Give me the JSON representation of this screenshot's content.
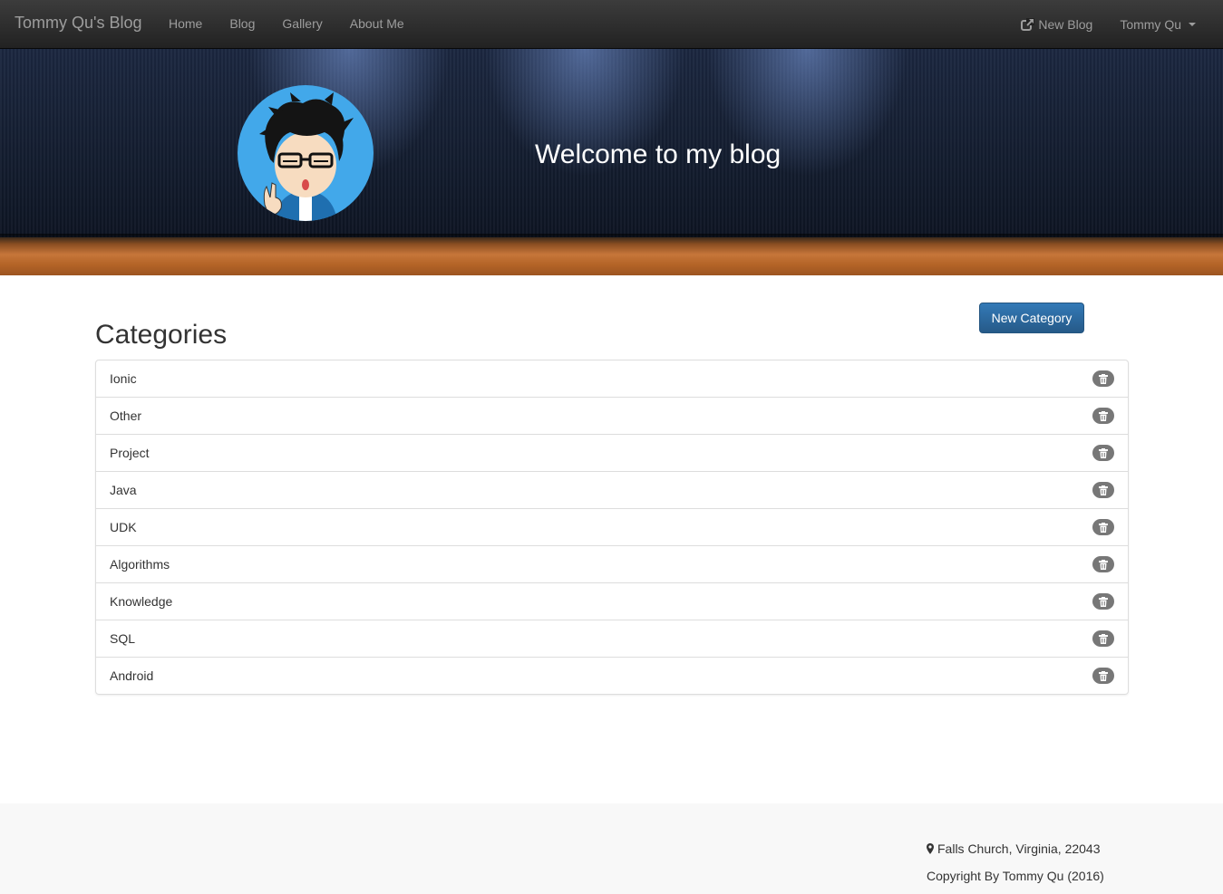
{
  "navbar": {
    "brand": "Tommy Qu's Blog",
    "links": [
      "Home",
      "Blog",
      "Gallery",
      "About Me"
    ],
    "new_blog": "New Blog",
    "user": "Tommy Qu"
  },
  "banner": {
    "welcome": "Welcome to my blog"
  },
  "main": {
    "new_category_button": "New Category",
    "title": "Categories",
    "categories": [
      "Ionic",
      "Other",
      "Project",
      "Java",
      "UDK",
      "Algorithms",
      "Knowledge",
      "SQL",
      "Android"
    ]
  },
  "footer": {
    "address": "Falls Church, Virginia, 22043",
    "copyright": "Copyright By Tommy Qu (2016)"
  },
  "icons": {
    "new_blog": "share-square-icon",
    "user_menu": "caret-down-icon",
    "delete": "trash-icon",
    "location": "map-marker-icon"
  },
  "colors": {
    "primary": "#337ab7",
    "navbar": "#222222",
    "badge": "#777777"
  }
}
